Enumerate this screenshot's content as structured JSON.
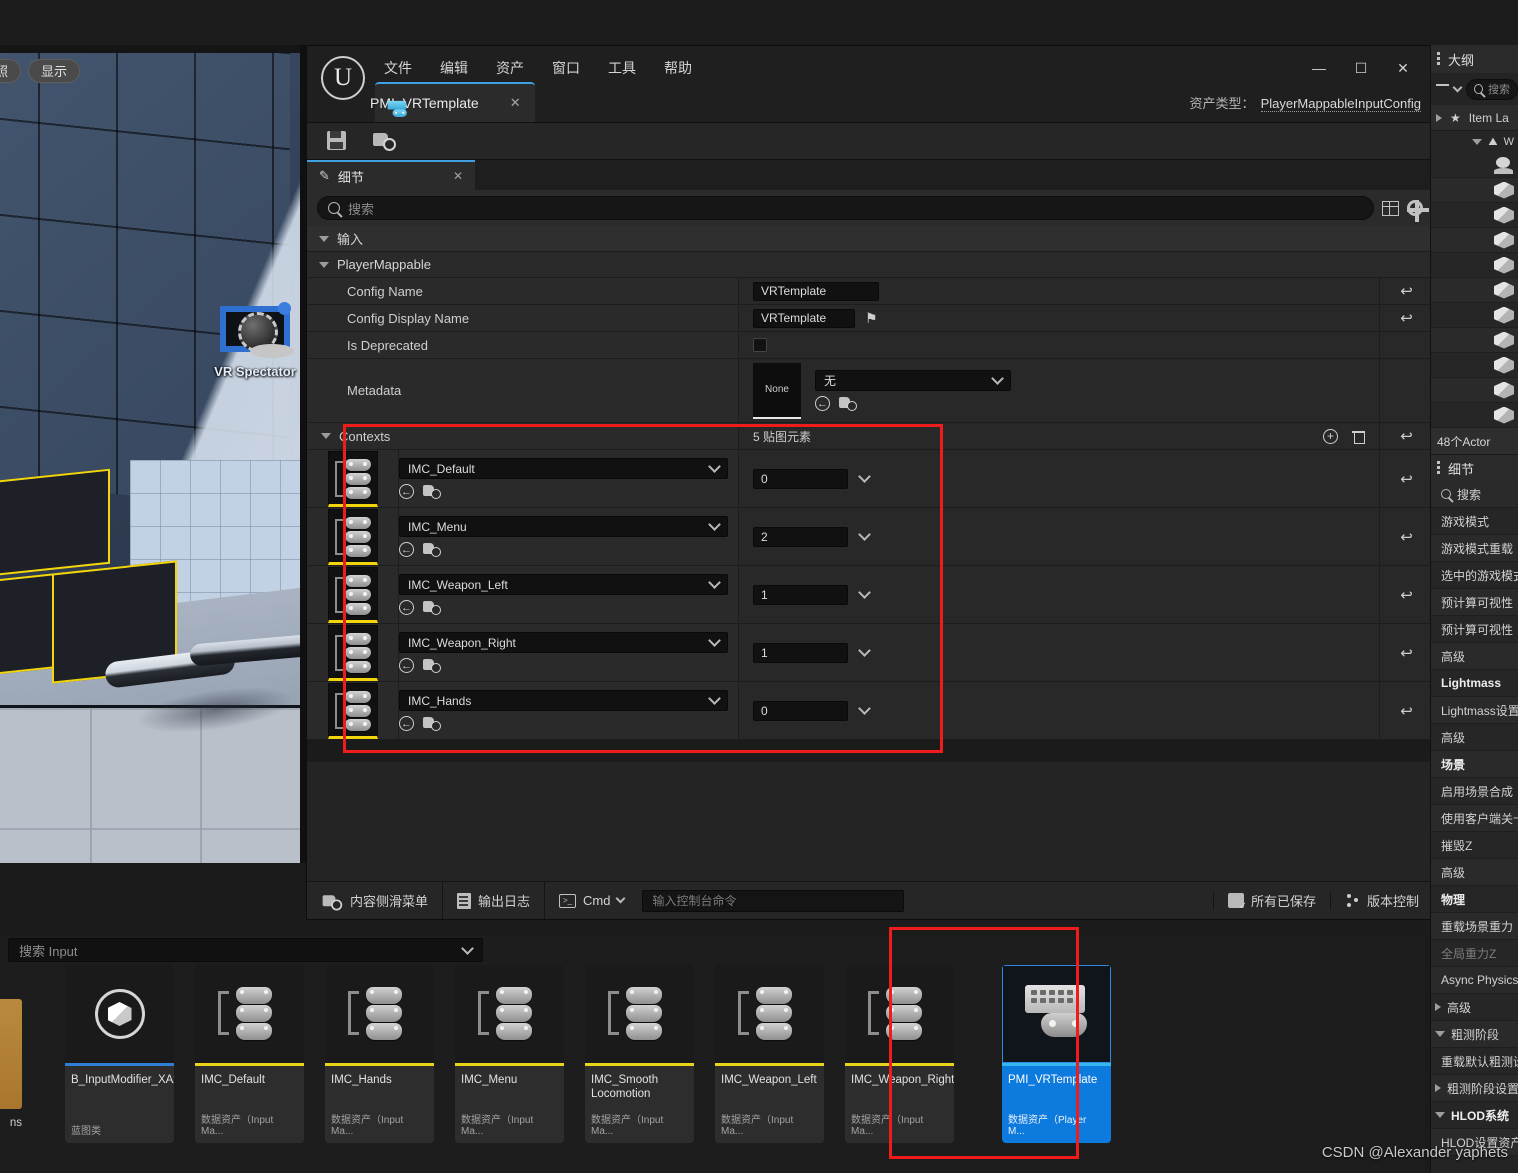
{
  "viewport": {
    "buttons": [
      "照",
      "显示"
    ],
    "actor_label": "VR Spectator"
  },
  "window": {
    "menu": [
      "文件",
      "编辑",
      "资产",
      "窗口",
      "工具",
      "帮助"
    ],
    "tab_label": "PMI_VRTemplate",
    "tab_close": "✕",
    "minimize": "—",
    "maximize": "☐",
    "close": "✕",
    "asset_type_label": "资产类型：",
    "asset_type_value": "PlayerMappableInputConfig",
    "logo": "U"
  },
  "toolbar": {
    "save_name": "save-icon",
    "browse_name": "browse-to-asset-icon"
  },
  "details_panel": {
    "tab_label": "细节",
    "tab_close": "✕",
    "search_placeholder": "搜索",
    "categories": {
      "input": "输入",
      "player_mappable": "PlayerMappable"
    },
    "rows": [
      {
        "label": "Config Name",
        "value": "VRTemplate",
        "type": "text",
        "revert": "↩"
      },
      {
        "label": "Config Display Name",
        "value": "VRTemplate",
        "type": "text-flag",
        "revert": "↩"
      },
      {
        "label": "Is Deprecated",
        "value": "",
        "type": "checkbox",
        "revert": ""
      },
      {
        "label": "Metadata",
        "value": "无",
        "thumb_label": "None",
        "type": "asset",
        "revert": ""
      }
    ],
    "contexts": {
      "label": "Contexts",
      "count_label": "5 贴图元素",
      "add_label": "+",
      "delete_name": "delete-all-icon",
      "items": [
        {
          "name": "IMC_Default",
          "priority": "0",
          "revert": "↩"
        },
        {
          "name": "IMC_Menu",
          "priority": "2",
          "revert": "↩"
        },
        {
          "name": "IMC_Weapon_Left",
          "priority": "1",
          "revert": "↩"
        },
        {
          "name": "IMC_Weapon_Right",
          "priority": "1",
          "revert": "↩"
        },
        {
          "name": "IMC_Hands",
          "priority": "0",
          "revert": "↩"
        }
      ]
    }
  },
  "status_bar": {
    "content_drawer": "内容侧滑菜单",
    "output_log": "输出日志",
    "cmd_label": "Cmd",
    "cmd_placeholder": "输入控制台命令",
    "all_saved": "所有已保存",
    "source_control": "版本控制"
  },
  "content_browser": {
    "search_placeholder": "搜索 Input",
    "partial_left_label": "ns",
    "items": [
      {
        "name": "B_InputModifier_XAxisPositiveOnly",
        "type": "蓝图类",
        "icon": "blueprint-sphere-icon",
        "strip": "#2f7fd6",
        "selected": false
      },
      {
        "name": "IMC_Default",
        "type": "数据资产（Input Ma...",
        "icon": "imc-icon",
        "strip": "#e8d51a",
        "selected": false
      },
      {
        "name": "IMC_Hands",
        "type": "数据资产（Input Ma...",
        "icon": "imc-icon",
        "strip": "#e8d51a",
        "selected": false
      },
      {
        "name": "IMC_Menu",
        "type": "数据资产（Input Ma...",
        "icon": "imc-icon",
        "strip": "#e8d51a",
        "selected": false
      },
      {
        "name": "IMC_Smooth Locomotion",
        "type": "数据资产（Input Ma...",
        "icon": "imc-icon",
        "strip": "#e8d51a",
        "selected": false
      },
      {
        "name": "IMC_Weapon_Left",
        "type": "数据资产（Input Ma...",
        "icon": "imc-icon",
        "strip": "#e8d51a",
        "selected": false
      },
      {
        "name": "IMC_Weapon_Right",
        "type": "数据资产（Input Ma...",
        "icon": "imc-icon",
        "strip": "#e8d51a",
        "selected": false
      },
      {
        "name": "PMI_VRTemplate",
        "type": "数据资产（Player M...",
        "icon": "pmi-icon",
        "strip": "#36b6ef",
        "selected": true
      }
    ]
  },
  "right_panel": {
    "outliner_title": "大纲",
    "search_placeholder": "搜索",
    "item_label_col": "Item La",
    "actor_count": "48个Actor",
    "details_title": "细节",
    "details_search": "搜索",
    "properties": [
      {
        "label": "游戏模式",
        "style": "alt"
      },
      {
        "label": "游戏模式重载",
        "style": ""
      },
      {
        "label": "选中的游戏模式",
        "style": "alt"
      },
      {
        "label": "预计算可视性",
        "style": ""
      },
      {
        "label": "预计算可视性",
        "style": "alt"
      },
      {
        "label": "高级",
        "style": ""
      },
      {
        "label": "Lightmass",
        "style": "bold"
      },
      {
        "label": "Lightmass设置",
        "style": "alt"
      },
      {
        "label": "高级",
        "style": ""
      },
      {
        "label": "场景",
        "style": "bold"
      },
      {
        "label": "启用场景合成",
        "style": "alt"
      },
      {
        "label": "使用客户端关卡",
        "style": ""
      },
      {
        "label": "摧毁Z",
        "style": "alt"
      },
      {
        "label": "高级",
        "style": ""
      },
      {
        "label": "物理",
        "style": "bold"
      },
      {
        "label": "重载场景重力",
        "style": "alt"
      },
      {
        "label": "全局重力Z",
        "style": "dim"
      },
      {
        "label": "Async Physics",
        "style": ""
      },
      {
        "label": "高级",
        "style": "arrow-right"
      },
      {
        "label": "粗测阶段",
        "style": "arrow-down"
      },
      {
        "label": "重载默认粗测设",
        "style": "alt"
      },
      {
        "label": "粗测阶段设置",
        "style": "arrow-right"
      },
      {
        "label": "HLOD系统",
        "style": "arrow-down-bold"
      },
      {
        "label": "HLOD设置资产",
        "style": "alt"
      }
    ]
  },
  "watermark": {
    "text": "CSDN @Alexander yaphets",
    "ghost": "阶段设置"
  },
  "colors": {
    "accent_blue": "#0d7ade",
    "highlight_red": "#f01c1c",
    "asset_yellow": "#e8d51a",
    "tab_blue": "#3f9fe0"
  }
}
